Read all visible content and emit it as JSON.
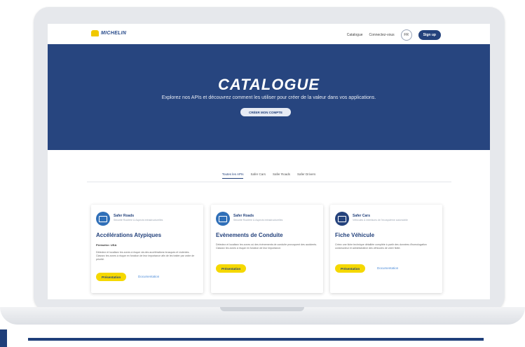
{
  "header": {
    "logo_text": "MICHELIN",
    "nav": [
      "Catalogue",
      "Connectez-vous"
    ],
    "lang": "FR",
    "signup": "Sign up"
  },
  "hero": {
    "title": "CATALOGUE",
    "subtitle": "Explorez nos APIs et découvrez comment les utiliser pour créer de la valeur dans vos applications.",
    "cta": "CRÉER MON COMPTE"
  },
  "tabs": [
    "Toutes les APIs",
    "Safer Cars",
    "Safer Roads",
    "Safer Drivers"
  ],
  "cards": [
    {
      "category": "Safer Roads",
      "category_sub": "Sécurité Routière & Aspects Infrastructurelles",
      "title": "Accélérations Atypiques",
      "meta": "Périmètre: USA",
      "desc": "Détectez et localisez les zones à risque via des accélérations brusques et violentes. Classez les zones à risque en fonction de leur importance afin de les traiter par ordre de priorité.",
      "button": "Présentation",
      "link": "Documentation"
    },
    {
      "category": "Safer Roads",
      "category_sub": "Sécurité Routière & Aspects Infrastructurelles",
      "title": "Evènements de Conduite",
      "desc": "Détectez et localisez les zones où des évènements de conduite provoquent des accidents. Classez les zones à risque en fonction de leur importance.",
      "button": "Présentation"
    },
    {
      "category": "Safer Cars",
      "category_sub": "Véhicules & Interfaces de l'écosystème automobile",
      "title": "Fiche Véhicule",
      "desc": "Créez une fiche technique détaillée complète à partir des données d'homologation constructeur et administrative des véhicules de votre flotte.",
      "button": "Présentation",
      "link": "Documentation"
    }
  ]
}
